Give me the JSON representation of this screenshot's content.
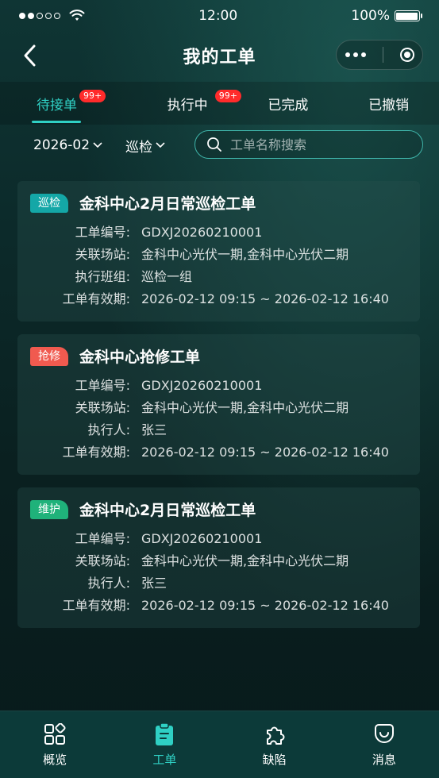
{
  "status_bar": {
    "time": "12:00",
    "battery": "100%"
  },
  "nav": {
    "title": "我的工单"
  },
  "tabs": [
    {
      "label": "待接单",
      "badge": "99+",
      "active": true
    },
    {
      "label": "执行中",
      "badge": "99+",
      "active": false
    },
    {
      "label": "已完成",
      "badge": "",
      "active": false
    },
    {
      "label": "已撤销",
      "badge": "",
      "active": false
    }
  ],
  "filters": {
    "date": "2026-02",
    "type": "巡检",
    "search_placeholder": "工单名称搜索"
  },
  "colors": {
    "accent": "#2fd0c4",
    "badge": "#ff2b2b",
    "tag_inspection": "#14a7a7",
    "tag_repair": "#f05a4f",
    "tag_maintenance": "#1fb27a"
  },
  "cards": [
    {
      "tag": "巡检",
      "title": "金科中心2月日常巡检工单",
      "rows": [
        {
          "label": "工单编号:",
          "value": "GDXJ20260210001"
        },
        {
          "label": "关联场站:",
          "value": "金科中心光伏一期,金科中心光伏二期"
        },
        {
          "label": "执行班组:",
          "value": "巡检一组"
        },
        {
          "label": "工单有效期:",
          "value": "2026-02-12  09:15  ~  2026-02-12  16:40"
        }
      ]
    },
    {
      "tag": "抢修",
      "title": "金科中心抢修工单",
      "rows": [
        {
          "label": "工单编号:",
          "value": "GDXJ20260210001"
        },
        {
          "label": "关联场站:",
          "value": "金科中心光伏一期,金科中心光伏二期"
        },
        {
          "label": "执行人:",
          "value": "张三"
        },
        {
          "label": "工单有效期:",
          "value": "2026-02-12  09:15  ~  2026-02-12  16:40"
        }
      ]
    },
    {
      "tag": "维护",
      "title": "金科中心2月日常巡检工单",
      "rows": [
        {
          "label": "工单编号:",
          "value": "GDXJ20260210001"
        },
        {
          "label": "关联场站:",
          "value": "金科中心光伏一期,金科中心光伏二期"
        },
        {
          "label": "执行人:",
          "value": "张三"
        },
        {
          "label": "工单有效期:",
          "value": "2026-02-12  09:15  ~  2026-02-12  16:40"
        }
      ]
    }
  ],
  "tabbar": [
    {
      "label": "概览",
      "icon": "overview-icon",
      "active": false
    },
    {
      "label": "工单",
      "icon": "work-order-icon",
      "active": true
    },
    {
      "label": "缺陷",
      "icon": "defect-icon",
      "active": false
    },
    {
      "label": "消息",
      "icon": "message-icon",
      "active": false
    }
  ]
}
